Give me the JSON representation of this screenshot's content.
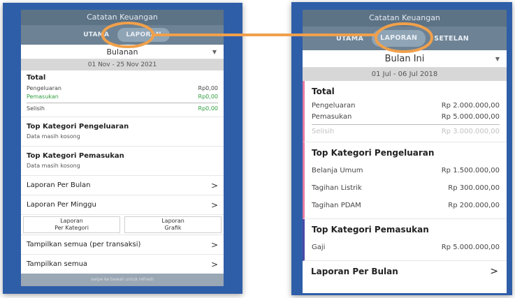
{
  "left": {
    "app_title": "Catatan Keuangan",
    "tabs": [
      "UTAMA",
      "LAPORAN"
    ],
    "dropdown_value": "Bulanan",
    "date_range": "01 Nov - 25 Nov 2021",
    "total": {
      "heading": "Total",
      "rows": [
        {
          "label": "Pengeluaran",
          "value": "Rp0,00"
        },
        {
          "label": "Pemasukan",
          "value": "Rp0,00"
        },
        {
          "label": "Selisih",
          "value": "Rp0,00"
        }
      ]
    },
    "top_pengeluaran": {
      "heading": "Top Kategori Pengeluaran",
      "empty": "Data masih kosong"
    },
    "top_pemasukan": {
      "heading": "Top Kategori Pemasukan",
      "empty": "Data masih kosong"
    },
    "nav": {
      "per_bulan": "Laporan Per Bulan",
      "per_minggu": "Laporan Per Minggu",
      "tampil_transaksi": "Tampilkan semua (per transaksi)",
      "tampil_semua": "Tampilkan semua"
    },
    "btn_kategori": [
      "Laporan",
      "Per Kategori"
    ],
    "btn_grafik": [
      "Laporan",
      "Grafik"
    ],
    "footer_hint": "swipe ke bawah untuk refresh"
  },
  "right": {
    "app_title": "Catatan Keuangan",
    "tabs": [
      "UTAMA",
      "LAPORAN",
      "SETELAN"
    ],
    "dropdown_value": "Bulan Ini",
    "date_range": "01 Jul - 06 Jul 2018",
    "total": {
      "heading": "Total",
      "rows": [
        {
          "label": "Pengeluaran",
          "value": "Rp 2.000.000,00"
        },
        {
          "label": "Pemasukan",
          "value": "Rp 5.000.000,00"
        },
        {
          "label": "Selisih",
          "value": "Rp 3.000.000,00"
        }
      ]
    },
    "top_pengeluaran": {
      "heading": "Top Kategori Pengeluaran",
      "rows": [
        {
          "label": "Belanja Umum",
          "value": "Rp 1.500.000,00"
        },
        {
          "label": "Tagihan Listrik",
          "value": "Rp 300.000,00"
        },
        {
          "label": "Tagihan PDAM",
          "value": "Rp 200.000,00"
        }
      ]
    },
    "top_pemasukan": {
      "heading": "Top Kategori Pemasukan",
      "rows": [
        {
          "label": "Gaji",
          "value": "Rp 5.000.000,00"
        }
      ]
    },
    "nav": {
      "per_bulan": "Laporan Per Bulan"
    }
  },
  "colors": {
    "frame": "#2f5ea8",
    "highlight": "#f0a04b",
    "income_green": "#2e9e3e",
    "accent_pink": "#e67aa5",
    "accent_purple": "#4a4aa8"
  },
  "icons": {
    "chevron": "chevron-right-icon",
    "dropdown": "caret-down-icon"
  }
}
